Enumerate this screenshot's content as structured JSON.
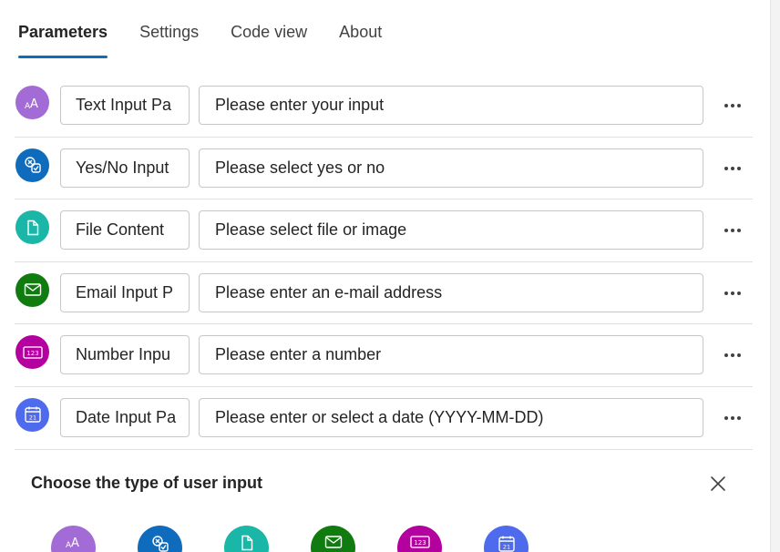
{
  "tabs": [
    {
      "label": "Parameters",
      "active": true
    },
    {
      "label": "Settings",
      "active": false
    },
    {
      "label": "Code view",
      "active": false
    },
    {
      "label": "About",
      "active": false
    }
  ],
  "parameters": [
    {
      "name": "Text Input Pa",
      "prompt": "Please enter your input",
      "icon": "text-icon",
      "color": "#a36bd6"
    },
    {
      "name": "Yes/No Input",
      "prompt": "Please select yes or no",
      "icon": "yes-no-icon",
      "color": "#0f6cbd"
    },
    {
      "name": "File Content",
      "prompt": "Please select file or image",
      "icon": "file-icon",
      "color": "#1ab7a8"
    },
    {
      "name": "Email Input P",
      "prompt": "Please enter an e-mail address",
      "icon": "email-icon",
      "color": "#107c10"
    },
    {
      "name": "Number Inpu",
      "prompt": "Please enter a number",
      "icon": "number-icon",
      "color": "#b4009e"
    },
    {
      "name": "Date Input Pa",
      "prompt": "Please enter or select a date (YYYY-MM-DD)",
      "icon": "calendar-icon",
      "color": "#4f6bed"
    }
  ],
  "chooser": {
    "title": "Choose the type of user input",
    "options": [
      {
        "icon": "text-icon",
        "color": "#a36bd6"
      },
      {
        "icon": "yes-no-icon",
        "color": "#0f6cbd"
      },
      {
        "icon": "file-icon",
        "color": "#1ab7a8"
      },
      {
        "icon": "email-icon",
        "color": "#107c10"
      },
      {
        "icon": "number-icon",
        "color": "#b4009e"
      },
      {
        "icon": "calendar-icon",
        "color": "#4f6bed"
      }
    ]
  },
  "icons": {
    "more": "more-horizontal-icon",
    "close": "close-icon"
  }
}
